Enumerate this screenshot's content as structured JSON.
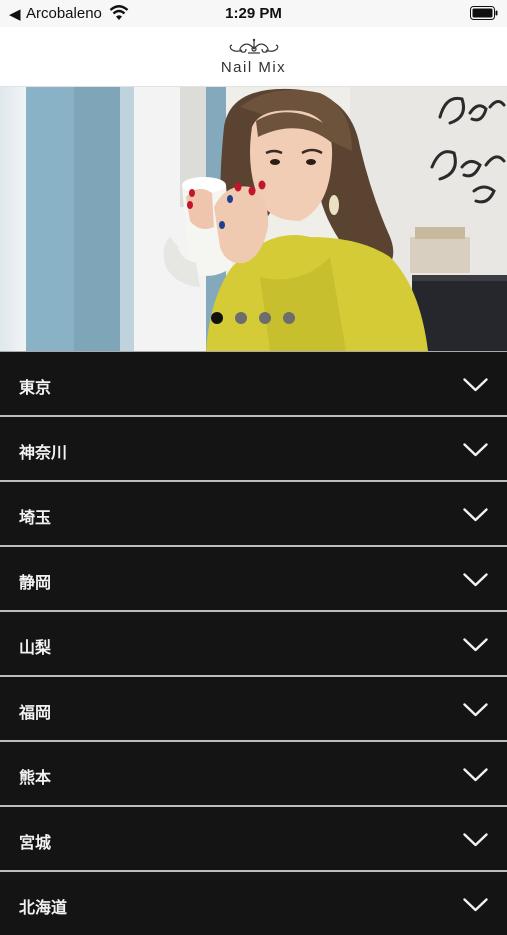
{
  "status_bar": {
    "back_glyph": "◀",
    "carrier": "Arcobaleno",
    "time": "1:29 PM",
    "icons": [
      "wifi-icon",
      "battery-icon"
    ]
  },
  "header": {
    "brand": "Nail Mix",
    "logo_icon": "ornament-icon"
  },
  "banner": {
    "slide_count": 4,
    "active_slide": 1
  },
  "regions": [
    {
      "label": "東京"
    },
    {
      "label": "神奈川"
    },
    {
      "label": "埼玉"
    },
    {
      "label": "静岡"
    },
    {
      "label": "山梨"
    },
    {
      "label": "福岡"
    },
    {
      "label": "熊本"
    },
    {
      "label": "宮城"
    },
    {
      "label": "北海道"
    }
  ],
  "colors": {
    "list_background": "#141414",
    "divider": "#bdbdbd",
    "header_background": "#ffffff",
    "status_bar_background": "#f7f7f7"
  }
}
